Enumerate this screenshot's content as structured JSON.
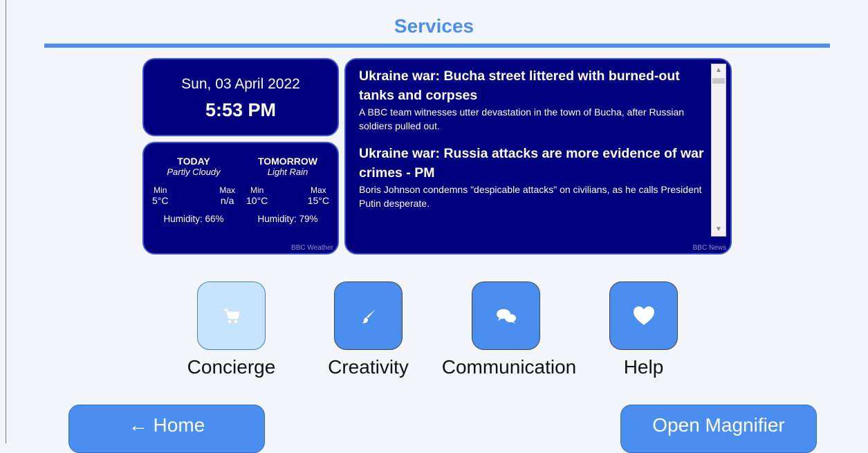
{
  "page": {
    "title": "Services"
  },
  "datetime": {
    "date": "Sun, 03 April 2022",
    "time": "5:53 PM"
  },
  "weather": {
    "today": {
      "day": "TODAY",
      "condition": "Partly Cloudy",
      "min_label": "Min",
      "min": "5°C",
      "max_label": "Max",
      "max": "n/a",
      "humidity": "Humidity: 66%"
    },
    "tomorrow": {
      "day": "TOMORROW",
      "condition": "Light Rain",
      "min_label": "Min",
      "min": "10°C",
      "max_label": "Max",
      "max": "15°C",
      "humidity": "Humidity: 79%"
    },
    "credit": "BBC Weather"
  },
  "news": {
    "items": [
      {
        "headline": "Ukraine war: Bucha street littered with burned-out tanks and corpses",
        "summary": "A BBC team witnesses utter devastation in the town of Bucha, after Russian soldiers pulled out."
      },
      {
        "headline": "Ukraine war: Russia attacks are more evidence of war crimes - PM",
        "summary": "Boris Johnson condemns \"despicable attacks\" on civilians, as he calls President Putin desperate."
      }
    ],
    "credit": "BBC News"
  },
  "services": [
    {
      "label": "Concierge",
      "icon": "cart-icon"
    },
    {
      "label": "Creativity",
      "icon": "paintbrush-icon"
    },
    {
      "label": "Communication",
      "icon": "chat-bubbles-icon"
    },
    {
      "label": "Help",
      "icon": "heart-icon"
    }
  ],
  "footer": {
    "home_label": "← Home",
    "magnifier_label": "Open Magnifier"
  },
  "colors": {
    "accent": "#4a8ff0",
    "card_bg": "#00007f",
    "active_tile": "#c7e4fc",
    "page_bg": "#f2f6fa"
  }
}
